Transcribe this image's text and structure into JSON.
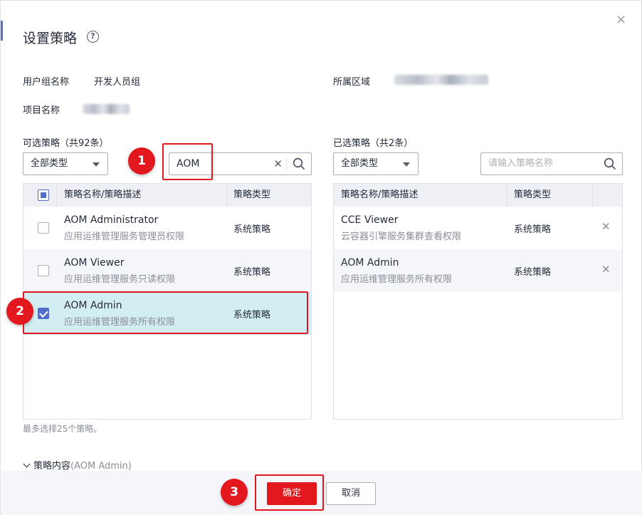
{
  "dialog": {
    "title": "设置策略",
    "help_icon": "help-circle-icon",
    "close_icon": "close-icon",
    "close_glyph": "×"
  },
  "meta": {
    "group_label": "用户组名称",
    "group_value": "开发人员组",
    "region_label": "所属区域",
    "project_label": "项目名称"
  },
  "available": {
    "label": "可选策略（共92条）",
    "type_select": "全部类型",
    "search_value": "AOM",
    "columns": [
      "策略名称/策略描述",
      "策略类型"
    ],
    "rows": [
      {
        "name": "AOM Administrator",
        "desc": "应用运维管理服务管理员权限",
        "type": "系统策略",
        "checked": false
      },
      {
        "name": "AOM Viewer",
        "desc": "应用运维管理服务只读权限",
        "type": "系统策略",
        "checked": false
      },
      {
        "name": "AOM Admin",
        "desc": "应用运维管理服务所有权限",
        "type": "系统策略",
        "checked": true
      }
    ]
  },
  "selected": {
    "label": "已选策略（共2条）",
    "type_select": "全部类型",
    "search_placeholder": "请输入策略名称",
    "columns": [
      "策略名称/策略描述",
      "策略类型"
    ],
    "rows": [
      {
        "name": "CCE Viewer",
        "desc": "云容器引擎服务集群查看权限",
        "type": "系统策略"
      },
      {
        "name": "AOM Admin",
        "desc": "应用运维管理服务所有权限",
        "type": "系统策略"
      }
    ]
  },
  "hint": "最多选择25个策略。",
  "policy_content": {
    "label": "策略内容",
    "sub": "(AOM Admin)"
  },
  "footer": {
    "confirm": "确定",
    "cancel": "取消"
  },
  "steps": [
    "1",
    "2",
    "3"
  ],
  "colors": {
    "accent": "#526ecc",
    "primary_button": "#e3181e",
    "highlight": "#e3181e",
    "selected_row": "#d2eef2"
  }
}
